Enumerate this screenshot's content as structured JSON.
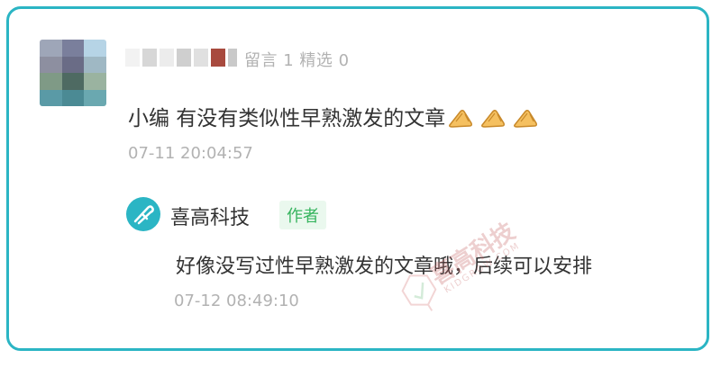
{
  "comment": {
    "stats": "留言 1 精选 0",
    "text": "小编 有没有类似性早熟激发的文章",
    "emoji": [
      "praying-hands-emoji",
      "praying-hands-emoji",
      "praying-hands-emoji"
    ],
    "time": "07-11 20:04:57"
  },
  "reply": {
    "author": "喜高科技",
    "badge": "作者",
    "text": "好像没写过性早熟激发的文章哦，后续可以安排",
    "time": "07-12 08:49:10"
  },
  "watermark": {
    "brand_cn": "喜高科技",
    "brand_en": "KIDGROW.COM"
  },
  "colors": {
    "border": "#2bb5c4",
    "meta_text": "#b2b2b2",
    "author_badge_text": "#36b45e",
    "author_badge_bg": "#eaf8ee"
  }
}
